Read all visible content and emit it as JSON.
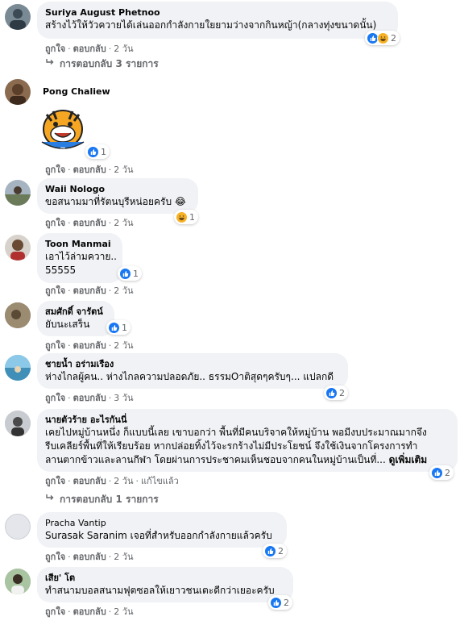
{
  "comments": [
    {
      "name": "Suriya August Phetnoo",
      "text": [
        "สร้างไว้ให้วัวควายได้เล่นออกกำลังกายใยยามว่างจากกินหญ้า(กลางทุ่งขนาดนั้น)"
      ],
      "reaction_count": "2",
      "reactions": [
        "like-icon",
        "haha-icon"
      ],
      "actions": {
        "like": "ถูกใจ",
        "reply": "ตอบกลับ",
        "time": "2 วัน"
      },
      "replies": "การตอบกลับ 3 รายการ"
    },
    {
      "name": "Pong Chaliew",
      "sticker": "tiger-sticker",
      "reaction_count": "1",
      "actions": {
        "like": "ถูกใจ",
        "reply": "ตอบกลับ",
        "time": "2 วัน"
      }
    },
    {
      "name": "Waii Nologo",
      "text": [
        "ขอสนามมาที่รัตนบุรีหน่อยครับ 😂"
      ],
      "reaction_count": "1",
      "actions": {
        "like": "ถูกใจ",
        "reply": "ตอบกลับ",
        "time": "2 วัน"
      }
    },
    {
      "name": "Toon Manmai",
      "text": [
        "เอาไว้ล่ามควาย..",
        "55555"
      ],
      "reaction_count": "1",
      "actions": {
        "like": "ถูกใจ",
        "reply": "ตอบกลับ",
        "time": "2 วัน"
      }
    },
    {
      "name": "สมศักดิ์ จารัตน์",
      "text": [
        "ยับนะเสร็น"
      ],
      "reaction_count": "1",
      "actions": {
        "like": "ถูกใจ",
        "reply": "ตอบกลับ",
        "time": "2 วัน"
      }
    },
    {
      "name": "ชายน้ำ อร่ามเรือง",
      "text": [
        "ห่างไกลผู้คน.. ห่างไกลความปลอดภัย.. ธรรมOาติสุดๆครับๆ... แปลกดี"
      ],
      "reaction_count": "2",
      "actions": {
        "like": "ถูกใจ",
        "reply": "ตอบกลับ",
        "time": "3 วัน"
      }
    },
    {
      "name": "นายตัวร้าย อะไรกันนี่",
      "text": [
        "เคยไปหมู่บ้านหนึ่ง ก็แบบนี้เลย เขาบอกว่า พื้นที่มีคนบริจาคให้หมู่บ้าน พอมีงบประมาณมากจึง",
        "รีบเคลียร์พื้นที่ให้เรียบร้อย หากปล่อยทิ้งไว้จะรกร้างไม่มีประโยชน์ จึงใช้เงินจากโครงการทำ",
        "ลานตากข้าวและลานกีฬา โดยผ่านการประชาคมเห็นชอบจากคนในหมู่บ้านเป็นที่..."
      ],
      "see_more": "ดูเพิ่มเติม",
      "reaction_count": "2",
      "actions": {
        "like": "ถูกใจ",
        "reply": "ตอบกลับ",
        "time": "2 วัน",
        "edited": "แก้ไขแล้ว"
      },
      "replies": "การตอบกลับ 1 รายการ"
    },
    {
      "name": "Pracha Vantip",
      "tag": "Surasak Saranim",
      "text": [
        "เจอที่สำหรับออกกำลังกายแล้วครับ"
      ],
      "reaction_count": "2",
      "actions": {
        "like": "ถูกใจ",
        "reply": "ตอบกลับ",
        "time": "2 วัน"
      }
    },
    {
      "name": "เสีย' โต",
      "text": [
        "ทำสนามบอลสนามฟุตซอลให้เยาวชนเตะดีกว่าเยอะครับ"
      ],
      "reaction_count": "2",
      "actions": {
        "like": "ถูกใจ",
        "reply": "ตอบกลับ",
        "time": "2 วัน"
      }
    }
  ],
  "colors": {
    "bubble": "#f0f2f5",
    "meta": "#65676b",
    "like": "#1877f2",
    "haha": "#f7b125"
  }
}
